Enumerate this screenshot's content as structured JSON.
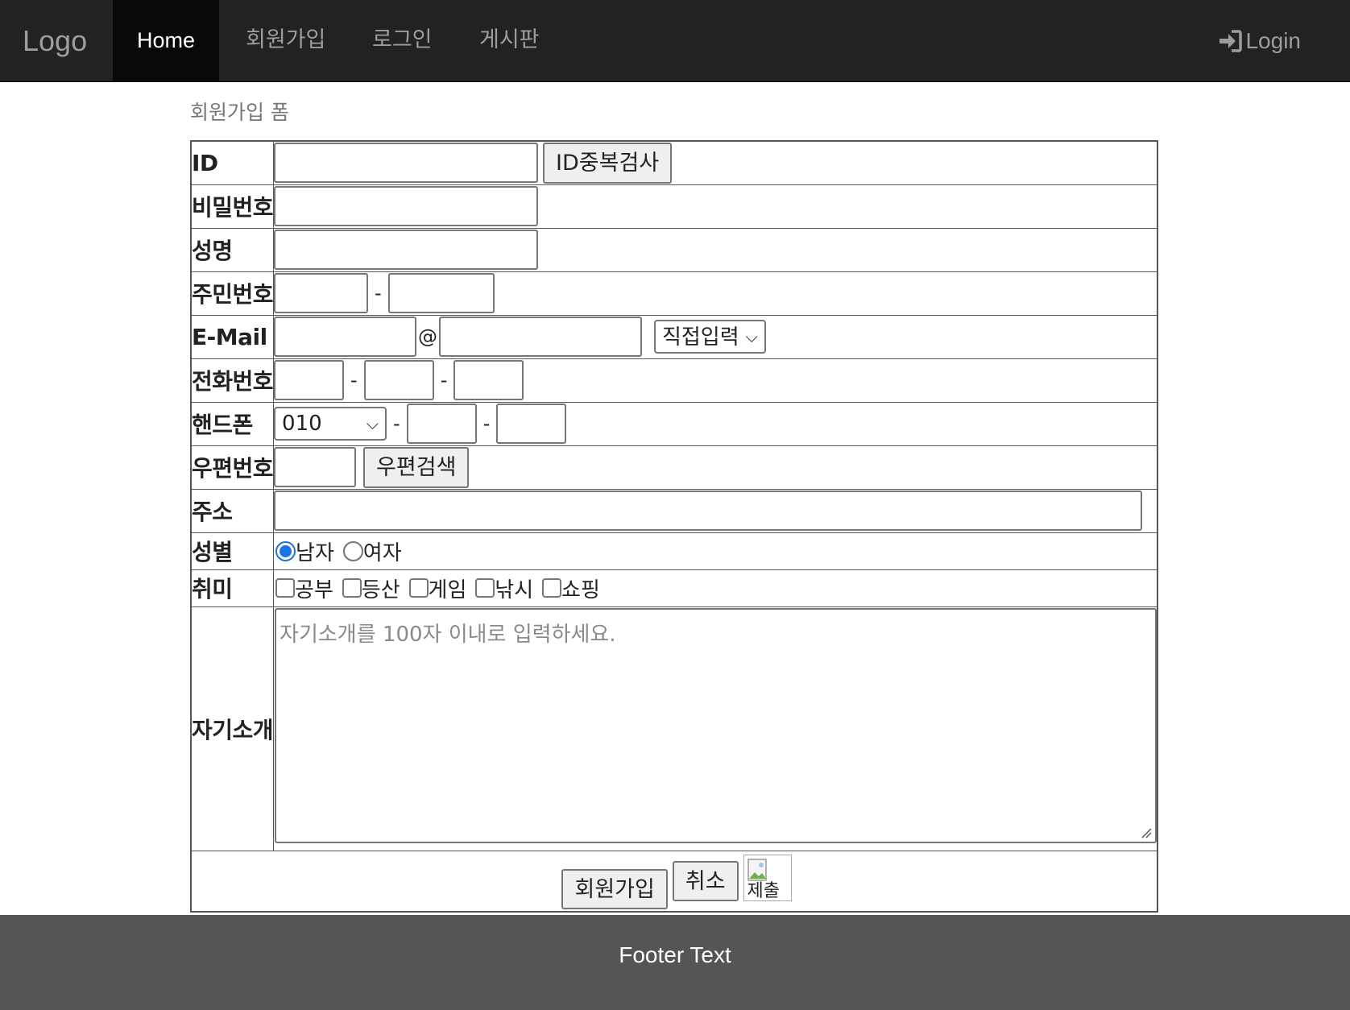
{
  "nav": {
    "brand": "Logo",
    "items": [
      {
        "label": "Home"
      },
      {
        "label": "회원가입"
      },
      {
        "label": "로그인"
      },
      {
        "label": "게시판"
      }
    ],
    "login": "Login"
  },
  "page_title": "회원가입 폼",
  "form": {
    "id_label": "ID",
    "id_check_button": "ID중복검사",
    "password_label": "비밀번호",
    "name_label": "성명",
    "jumin_label": "주민번호",
    "jumin_sep": "-",
    "email_label": "E-Mail",
    "email_at": "@",
    "email_domain_selected": "직접입력",
    "phone_label": "전화번호",
    "phone_sep": "-",
    "mobile_label": "핸드폰",
    "mobile_prefix_selected": "010",
    "mobile_sep": "-",
    "zip_label": "우편번호",
    "zip_search_button": "우편검색",
    "address_label": "주소",
    "gender_label": "성별",
    "gender_options": [
      "남자",
      "여자"
    ],
    "gender_selected": "남자",
    "hobby_label": "취미",
    "hobby_options": [
      "공부",
      "등산",
      "게임",
      "낚시",
      "쇼핑"
    ],
    "intro_label": "자기소개",
    "intro_placeholder": "자기소개를 100자 이내로 입력하세요.",
    "submit_button": "회원가입",
    "cancel_button": "취소",
    "image_alt": "제출"
  },
  "footer": {
    "text": "Footer Text"
  },
  "colors": {
    "navbar": "#222222",
    "nav_active": "#080808",
    "footer": "#555555",
    "radio_accent": "#1a73e8"
  }
}
